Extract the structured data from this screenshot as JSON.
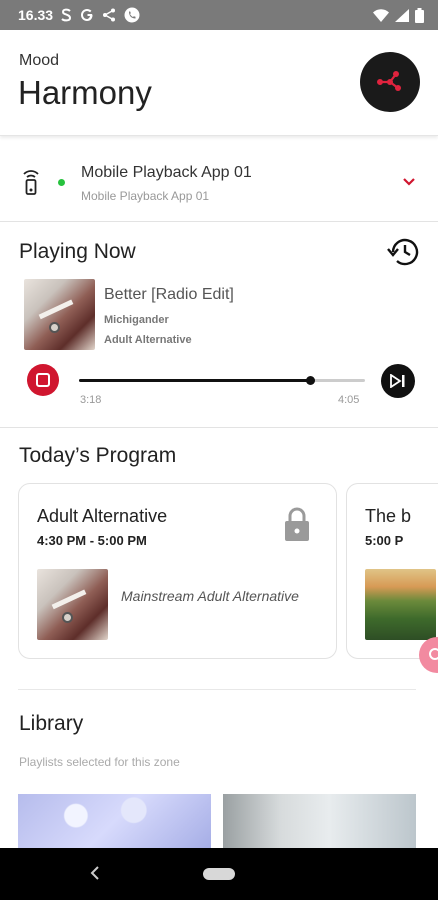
{
  "status_bar": {
    "time": "16.33",
    "icons": [
      "s-app-icon",
      "google-icon",
      "share-icon",
      "phone-icon",
      "wifi-icon",
      "signal-icon",
      "battery-icon"
    ]
  },
  "header": {
    "subtitle": "Mood",
    "title": "Harmony",
    "logo_icon": "network-logo-icon"
  },
  "zone": {
    "name": "Mobile Playback App 01",
    "subname": "Mobile Playback App 01",
    "status_color": "#27c23e"
  },
  "playing_now": {
    "title": "Playing Now",
    "track": "Better [Radio Edit]",
    "artist": "Michigander",
    "genre": "Adult Alternative",
    "elapsed": "3:18",
    "duration": "4:05",
    "progress_fraction": 0.808
  },
  "program": {
    "title": "Today’s Program",
    "cards": [
      {
        "title": "Adult Alternative",
        "time": "4:30 PM - 5:00 PM",
        "description": "Mainstream Adult Alternative",
        "locked": true
      },
      {
        "title": "The b",
        "time": "5:00 P"
      }
    ]
  },
  "library": {
    "title": "Library",
    "hint": "Playlists selected for this zone"
  },
  "colors": {
    "accent": "#d0162f",
    "fab": "#f28aa0"
  }
}
